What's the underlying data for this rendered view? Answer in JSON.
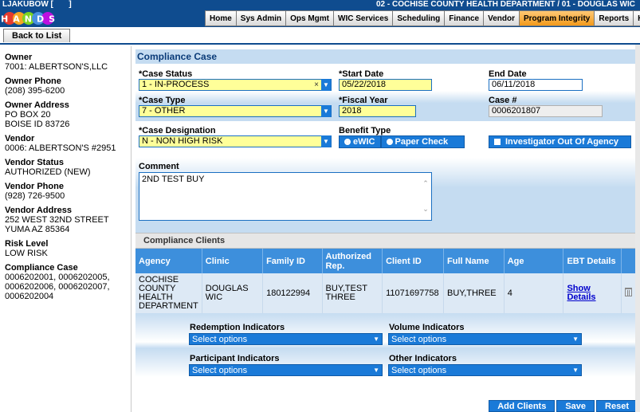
{
  "header": {
    "user": "LJAKUBOW [",
    "user_suffix": "]",
    "agency": "02 - COCHISE COUNTY HEALTH DEPARTMENT / 01 - DOUGLAS WIC",
    "logo_text": "HANDS",
    "nav": [
      "Home",
      "Sys Admin",
      "Ops Mgmt",
      "WIC Services",
      "Scheduling",
      "Finance",
      "Vendor",
      "Program Integrity",
      "Reports",
      "Help"
    ],
    "active_nav": "Program Integrity"
  },
  "back_button": "Back to List",
  "left": {
    "owner_label": "Owner",
    "owner": "7001: ALBERTSON'S,LLC",
    "owner_phone_label": "Owner Phone",
    "owner_phone": "(208) 395-6200",
    "owner_address_label": "Owner Address",
    "owner_address": "PO BOX 20\nBOISE ID 83726",
    "vendor_label": "Vendor",
    "vendor": "0006: ALBERTSON'S #2951",
    "vendor_status_label": "Vendor Status",
    "vendor_status": "AUTHORIZED (NEW)",
    "vendor_phone_label": "Vendor Phone",
    "vendor_phone": "(928) 726-9500",
    "vendor_address_label": "Vendor Address",
    "vendor_address": "252 WEST 32ND STREET\nYUMA AZ 85364",
    "risk_label": "Risk Level",
    "risk": "LOW RISK",
    "compliance_case_label": "Compliance Case",
    "compliance_case": "0006202001, 0006202005,\n0006202006, 0006202007,\n0006202004"
  },
  "form": {
    "title": "Compliance Case",
    "case_status_label": "*Case Status",
    "case_status": "1 - IN-PROCESS",
    "start_date_label": "*Start Date",
    "start_date": "05/22/2018",
    "end_date_label": "End Date",
    "end_date": "06/11/2018",
    "case_type_label": "*Case Type",
    "case_type": "7 - OTHER",
    "fiscal_year_label": "*Fiscal Year",
    "fiscal_year": "2018",
    "case_number_label": "Case #",
    "case_number": "0006201807",
    "designation_label": "*Case Designation",
    "designation": "N - NON HIGH RISK",
    "benefit_type_label": "Benefit Type",
    "benefit_ewic": "eWIC",
    "benefit_paper": "Paper Check",
    "investigator_label": "Investigator Out Of Agency",
    "comment_label": "Comment",
    "comment": "2ND TEST BUY",
    "clear_symbol": "×"
  },
  "clients": {
    "title": "Compliance Clients",
    "columns": [
      "Agency",
      "Clinic",
      "Family ID",
      "Authorized Rep.",
      "Client ID",
      "Full Name",
      "Age",
      "EBT Details"
    ],
    "rows": [
      {
        "agency": "COCHISE COUNTY HEALTH DEPARTMENT",
        "clinic": "DOUGLAS WIC",
        "family_id": "180122994",
        "authorized_rep": "BUY,TEST THREE",
        "client_id": "11071697758",
        "full_name": "BUY,THREE",
        "age": "4",
        "ebt": "Show Details"
      }
    ]
  },
  "indicators": {
    "redemption_label": "Redemption Indicators",
    "volume_label": "Volume Indicators",
    "participant_label": "Participant Indicators",
    "other_label": "Other Indicators",
    "placeholder": "Select options"
  },
  "buttons": {
    "add_clients": "Add Clients",
    "save": "Save",
    "reset": "Reset"
  }
}
